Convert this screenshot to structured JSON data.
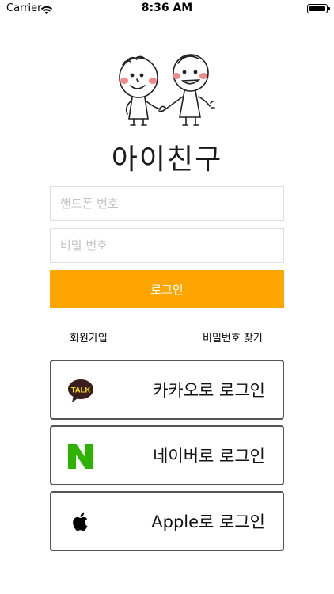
{
  "status_bar": {
    "carrier": "Carrier",
    "time": "8:36 AM"
  },
  "app": {
    "title": "아이친구"
  },
  "login_form": {
    "phone_placeholder": "핸드폰 번호",
    "password_placeholder": "비밀 번호",
    "login_label": "로그인"
  },
  "links": {
    "signup": "회원가입",
    "find_password": "비밀번호 찾기"
  },
  "social_login": {
    "kakao": {
      "label": "카카오로 로그인",
      "icon": "kakao-talk-icon",
      "badge": "TALK",
      "color": "#3a1d1d"
    },
    "naver": {
      "label": "네이버로 로그인",
      "icon": "naver-icon",
      "color": "#2db400"
    },
    "apple": {
      "label": "Apple로 로그인",
      "icon": "apple-icon",
      "color": "#000000"
    }
  },
  "colors": {
    "accent": "#ffa500",
    "input_border": "#dedede",
    "social_border": "#555555"
  }
}
